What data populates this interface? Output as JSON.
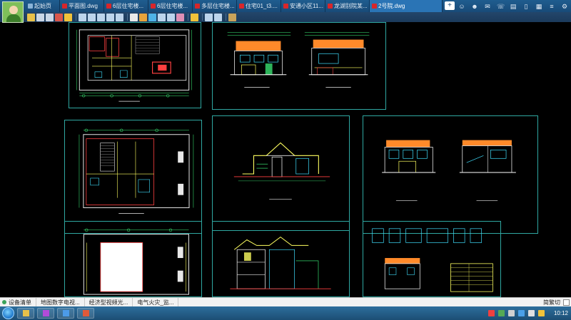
{
  "browser": {
    "tabs": [
      {
        "label": "起始页",
        "fav": "#8ab4d8"
      },
      {
        "label": "平面图.dwg",
        "fav": "#d8262a"
      },
      {
        "label": "6层住宅楼...",
        "fav": "#d8262a"
      },
      {
        "label": "6层住宅楼...",
        "fav": "#d8262a"
      },
      {
        "label": "多层住宅楼...",
        "fav": "#d8262a"
      },
      {
        "label": "住宅01_t3....",
        "fav": "#d8262a"
      },
      {
        "label": "安通小区11...",
        "fav": "#d8262a"
      },
      {
        "label": "龙湖别院某...",
        "fav": "#d8262a"
      },
      {
        "label": "2号院.dwg",
        "fav": "#d8262a"
      }
    ],
    "active_tab": 8,
    "new_tab_label": "+",
    "tray_icons": [
      "people-icon",
      "user-icon",
      "mail-icon",
      "phone-icon",
      "chat-icon",
      "file-icon",
      "grid-icon",
      "list-icon",
      "gear-icon"
    ]
  },
  "toolbar": {
    "icons": [
      {
        "name": "open-folder-icon",
        "color": "#e8c14a"
      },
      {
        "name": "save-icon",
        "color": "#c9d6e6"
      },
      {
        "name": "print-icon",
        "color": "#c9d6e6"
      },
      {
        "name": "export-icon",
        "color": "#d9564b"
      },
      {
        "name": "lock-icon",
        "color": "#f0c23a"
      },
      {
        "sep": true
      },
      {
        "name": "refresh-icon",
        "color": "#bcd4ec"
      },
      {
        "name": "zoom-window-icon",
        "color": "#bcd4ec"
      },
      {
        "name": "zoom-icon",
        "color": "#bcd4ec"
      },
      {
        "name": "zoom-extents-icon",
        "color": "#bcd4ec"
      },
      {
        "name": "pan-icon",
        "color": "#bcd4ec"
      },
      {
        "sep": true
      },
      {
        "name": "text-icon",
        "color": "#e9e9e9"
      },
      {
        "name": "pencil-icon",
        "color": "#e8a33a"
      },
      {
        "name": "marker-icon",
        "color": "#4fb2e6"
      },
      {
        "name": "undo-icon",
        "color": "#bcd4ec"
      },
      {
        "name": "redo-icon",
        "color": "#bcd4ec"
      },
      {
        "name": "erase-icon",
        "color": "#e08fb5"
      },
      {
        "sep": true
      },
      {
        "name": "layers-icon",
        "color": "#f0c23a"
      },
      {
        "sep": true
      },
      {
        "name": "layout-icon",
        "color": "#bcd4ec"
      },
      {
        "name": "measure-icon",
        "color": "#bcd4ec"
      },
      {
        "sep": true
      },
      {
        "name": "3d-icon",
        "color": "#c9a35a"
      }
    ]
  },
  "bottom_tabs": [
    {
      "label": "设备清单"
    },
    {
      "label": "地图数字电视..."
    },
    {
      "label": "经济型视频光..."
    },
    {
      "label": "电气火灾_监..."
    }
  ],
  "zoom": {
    "label": "简繁切"
  },
  "taskbar": {
    "clock": "10:12",
    "apps": [
      {
        "name": "explorer-app-icon",
        "color": "#e8c14a"
      },
      {
        "name": "media-app-icon",
        "color": "#b24bd9"
      },
      {
        "name": "photo-app-icon",
        "color": "#4c9be8"
      },
      {
        "name": "cad-viewer-app-icon",
        "color": "#e05a3a"
      }
    ],
    "tray_colors": [
      "#f04040",
      "#55aa55",
      "#d0d0d0",
      "#4aa0e8",
      "#e0e0e0",
      "#f0c23a"
    ]
  }
}
